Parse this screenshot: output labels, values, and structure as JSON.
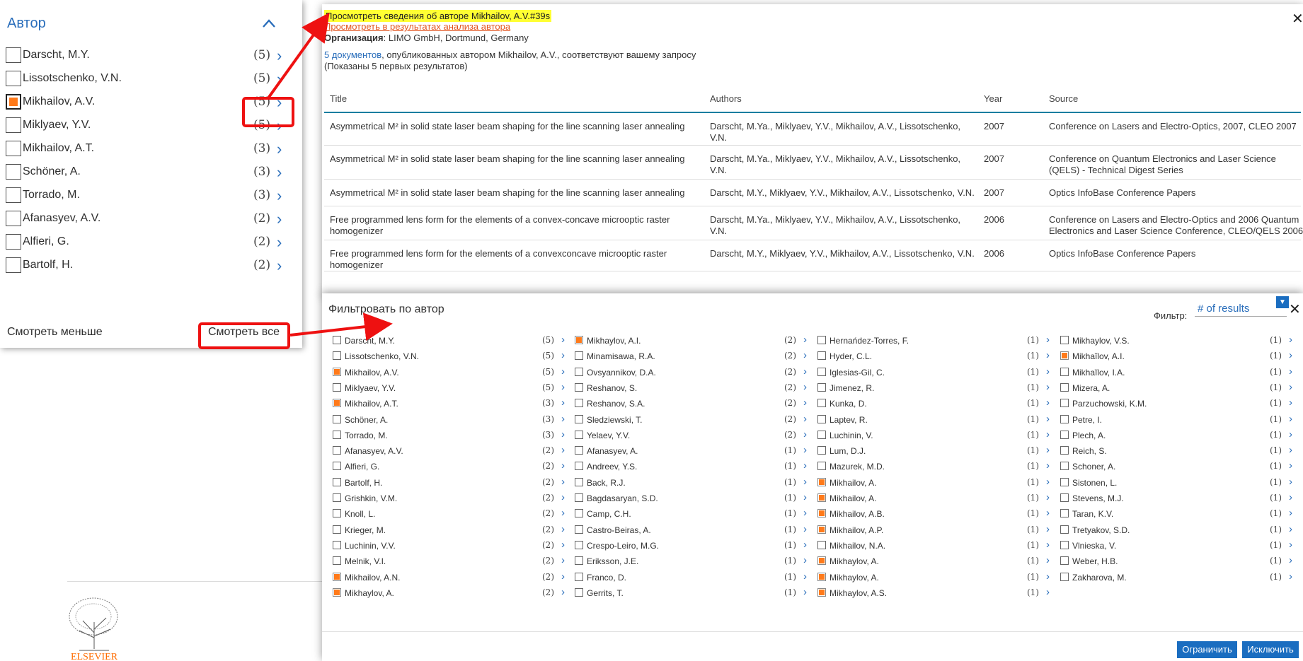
{
  "left_panel": {
    "heading": "Автор",
    "authors": [
      {
        "name": "Darscht, M.Y.",
        "count": "(5)",
        "checked": false
      },
      {
        "name": "Lissotschenko, V.N.",
        "count": "(5)",
        "checked": false
      },
      {
        "name": "Mikhailov, A.V.",
        "count": "(5)",
        "checked": true
      },
      {
        "name": "Miklyaev, Y.V.",
        "count": "(5)",
        "checked": false
      },
      {
        "name": "Mikhailov, A.T.",
        "count": "(3)",
        "checked": false
      },
      {
        "name": "Schöner, A.",
        "count": "(3)",
        "checked": false
      },
      {
        "name": "Torrado, M.",
        "count": "(3)",
        "checked": false
      },
      {
        "name": "Afanasyev, A.V.",
        "count": "(2)",
        "checked": false
      },
      {
        "name": "Alfieri, G.",
        "count": "(2)",
        "checked": false
      },
      {
        "name": "Bartolf, H.",
        "count": "(2)",
        "checked": false
      }
    ],
    "see_less": "Смотреть меньше",
    "see_all": "Смотреть все"
  },
  "logo": {
    "text": "ELSEVIER",
    "color": "#ff6c00"
  },
  "author_dialog": {
    "view_author": "Просмотреть сведения об авторе Mikhailov, A.V.#39s",
    "view_in_analysis": "Просмотреть в результатах анализа автора",
    "org_label": "Организация",
    "org_value": ": LIMO GmbH, Dortmund, Germany",
    "docs_link": "5 документов",
    "docs_text": ", опубликованных автором Mikhailov, A.V., соответствуют вашему запросу",
    "shown_text": "(Показаны 5 первых результатов)",
    "columns": {
      "title": "Title",
      "authors": "Authors",
      "year": "Year",
      "source": "Source"
    },
    "rows": [
      {
        "title": "Asymmetrical M² in solid state laser beam shaping for the line scanning laser annealing",
        "authors": "Darscht, M.Ya., Miklyaev, Y.V., Mikhailov, A.V., Lissotschenko, V.N.",
        "year": "2007",
        "source": "Conference on Lasers and Electro-Optics, 2007, CLEO 2007"
      },
      {
        "title": "Asymmetrical M² in solid state laser beam shaping for the line scanning laser annealing",
        "authors": "Darscht, M.Ya., Miklyaev, Y.V., Mikhailov, A.V., Lissotschenko, V.N.",
        "year": "2007",
        "source": "Conference on Quantum Electronics and Laser Science (QELS) - Technical Digest Series"
      },
      {
        "title": "Asymmetrical M² in solid state laser beam shaping for the line scanning laser annealing",
        "authors": "Darscht, M.Y., Miklyaev, Y.V., Mikhailov, A.V., Lissotschenko, V.N.",
        "year": "2007",
        "source": "Optics InfoBase Conference Papers"
      },
      {
        "title": "Free programmed lens form for the elements of a convex-concave microoptic raster homogenizer",
        "authors": "Darscht, M.Ya., Miklyaev, Y.V., Mikhailov, A.V., Lissotschenko, V.N.",
        "year": "2006",
        "source": "Conference on Lasers and Electro-Optics and 2006 Quantum Electronics and Laser Science Conference, CLEO/QELS 2006"
      },
      {
        "title": "Free programmed lens form for the elements of a convexconcave microoptic raster homogenizer",
        "authors": "Darscht, M.Y., Miklyaev, Y.V., Mikhailov, A.V., Lissotschenko, V.N.",
        "year": "2006",
        "source": "Optics InfoBase Conference Papers"
      }
    ]
  },
  "filter_dialog": {
    "title": "Фильтровать по автор",
    "filter_label": "Фильтр:",
    "filter_value": "# of results",
    "limit_button": "Ограничить",
    "exclude_button": "Исключить",
    "columns": [
      [
        {
          "name": "Darscht, M.Y.",
          "count": "(5)",
          "checked": false
        },
        {
          "name": "Lissotschenko, V.N.",
          "count": "(5)",
          "checked": false
        },
        {
          "name": "Mikhailov, A.V.",
          "count": "(5)",
          "checked": true
        },
        {
          "name": "Miklyaev, Y.V.",
          "count": "(5)",
          "checked": false
        },
        {
          "name": "Mikhailov, A.T.",
          "count": "(3)",
          "checked": true
        },
        {
          "name": "Schöner, A.",
          "count": "(3)",
          "checked": false
        },
        {
          "name": "Torrado, M.",
          "count": "(3)",
          "checked": false
        },
        {
          "name": "Afanasyev, A.V.",
          "count": "(2)",
          "checked": false
        },
        {
          "name": "Alfieri, G.",
          "count": "(2)",
          "checked": false
        },
        {
          "name": "Bartolf, H.",
          "count": "(2)",
          "checked": false
        },
        {
          "name": "Grishkin, V.M.",
          "count": "(2)",
          "checked": false
        },
        {
          "name": "Knoll, L.",
          "count": "(2)",
          "checked": false
        },
        {
          "name": "Krieger, M.",
          "count": "(2)",
          "checked": false
        },
        {
          "name": "Luchinin, V.V.",
          "count": "(2)",
          "checked": false
        },
        {
          "name": "Melnik, V.I.",
          "count": "(2)",
          "checked": false
        },
        {
          "name": "Mikhailov, A.N.",
          "count": "(2)",
          "checked": true
        },
        {
          "name": "Mikhaylov, A.",
          "count": "(2)",
          "checked": true
        }
      ],
      [
        {
          "name": "Mikhaylov, A.I.",
          "count": "(2)",
          "checked": true
        },
        {
          "name": "Minamisawa, R.A.",
          "count": "(2)",
          "checked": false
        },
        {
          "name": "Ovsyannikov, D.A.",
          "count": "(2)",
          "checked": false
        },
        {
          "name": "Reshanov, S.",
          "count": "(2)",
          "checked": false
        },
        {
          "name": "Reshanov, S.A.",
          "count": "(2)",
          "checked": false
        },
        {
          "name": "Sledziewski, T.",
          "count": "(2)",
          "checked": false
        },
        {
          "name": "Yelaev, Y.V.",
          "count": "(2)",
          "checked": false
        },
        {
          "name": "Afanasyev, A.",
          "count": "(1)",
          "checked": false
        },
        {
          "name": "Andreev, Y.S.",
          "count": "(1)",
          "checked": false
        },
        {
          "name": "Back, R.J.",
          "count": "(1)",
          "checked": false
        },
        {
          "name": "Bagdasaryan, S.D.",
          "count": "(1)",
          "checked": false
        },
        {
          "name": "Camp, C.H.",
          "count": "(1)",
          "checked": false
        },
        {
          "name": "Castro-Beiras, A.",
          "count": "(1)",
          "checked": false
        },
        {
          "name": "Crespo-Leiro, M.G.",
          "count": "(1)",
          "checked": false
        },
        {
          "name": "Eriksson, J.E.",
          "count": "(1)",
          "checked": false
        },
        {
          "name": "Franco, D.",
          "count": "(1)",
          "checked": false
        },
        {
          "name": "Gerrits, T.",
          "count": "(1)",
          "checked": false
        }
      ],
      [
        {
          "name": "Hernańdez-Torres, F.",
          "count": "(1)",
          "checked": false
        },
        {
          "name": "Hyder, C.L.",
          "count": "(1)",
          "checked": false
        },
        {
          "name": "Iglesias-Gil, C.",
          "count": "(1)",
          "checked": false
        },
        {
          "name": "Jimenez, R.",
          "count": "(1)",
          "checked": false
        },
        {
          "name": "Kunka, D.",
          "count": "(1)",
          "checked": false
        },
        {
          "name": "Laptev, R.",
          "count": "(1)",
          "checked": false
        },
        {
          "name": "Luchinin, V.",
          "count": "(1)",
          "checked": false
        },
        {
          "name": "Lum, D.J.",
          "count": "(1)",
          "checked": false
        },
        {
          "name": "Mazurek, M.D.",
          "count": "(1)",
          "checked": false
        },
        {
          "name": "Mikhailov, A.",
          "count": "(1)",
          "checked": true
        },
        {
          "name": "Mikhailov, A.",
          "count": "(1)",
          "checked": true
        },
        {
          "name": "Mikhailov, A.B.",
          "count": "(1)",
          "checked": true
        },
        {
          "name": "Mikhailov, A.P.",
          "count": "(1)",
          "checked": true
        },
        {
          "name": "Mikhailov, N.A.",
          "count": "(1)",
          "checked": false
        },
        {
          "name": "Mikhaylov, A.",
          "count": "(1)",
          "checked": true
        },
        {
          "name": "Mikhaylov, A.",
          "count": "(1)",
          "checked": true
        },
        {
          "name": "Mikhaylov, A.S.",
          "count": "(1)",
          "checked": true
        }
      ],
      [
        {
          "name": "Mikhaylov, V.S.",
          "count": "(1)",
          "checked": false
        },
        {
          "name": "Mikhaĭlov, A.I.",
          "count": "(1)",
          "checked": true
        },
        {
          "name": "Mikhaĭlov, I.A.",
          "count": "(1)",
          "checked": false
        },
        {
          "name": "Mizera, A.",
          "count": "(1)",
          "checked": false
        },
        {
          "name": "Parzuchowski, K.M.",
          "count": "(1)",
          "checked": false
        },
        {
          "name": "Petre, I.",
          "count": "(1)",
          "checked": false
        },
        {
          "name": "Plech, A.",
          "count": "(1)",
          "checked": false
        },
        {
          "name": "Reich, S.",
          "count": "(1)",
          "checked": false
        },
        {
          "name": "Schoner, A.",
          "count": "(1)",
          "checked": false
        },
        {
          "name": "Sistonen, L.",
          "count": "(1)",
          "checked": false
        },
        {
          "name": "Stevens, M.J.",
          "count": "(1)",
          "checked": false
        },
        {
          "name": "Taran, K.V.",
          "count": "(1)",
          "checked": false
        },
        {
          "name": "Tretyakov, S.D.",
          "count": "(1)",
          "checked": false
        },
        {
          "name": "Vlnieska, V.",
          "count": "(1)",
          "checked": false
        },
        {
          "name": "Weber, H.B.",
          "count": "(1)",
          "checked": false
        },
        {
          "name": "Zakharova, M.",
          "count": "(1)",
          "checked": false
        }
      ]
    ]
  },
  "colors": {
    "accent_blue": "#2a6ebb",
    "button_blue": "#1a6dc0",
    "checked_orange": "#ff7a1a",
    "annotation_red": "#ee1111",
    "highlight_yellow": "#ffff33"
  }
}
